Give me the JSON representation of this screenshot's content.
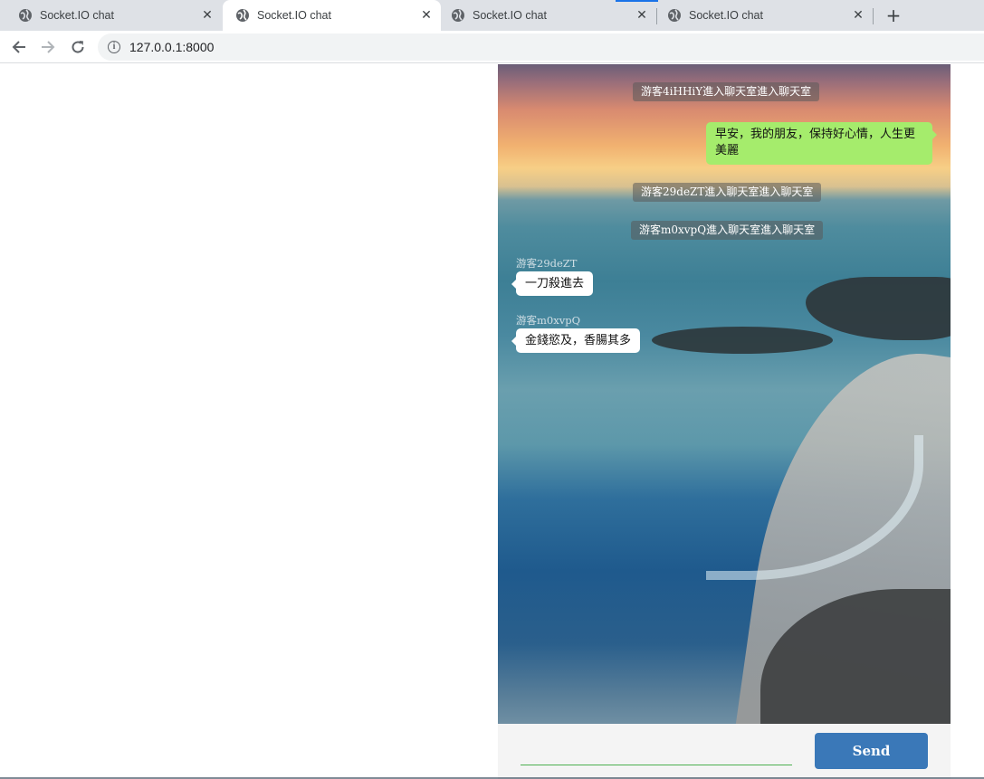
{
  "browser": {
    "tabs": [
      {
        "title": "Socket.IO chat",
        "active": false
      },
      {
        "title": "Socket.IO chat",
        "active": true
      },
      {
        "title": "Socket.IO chat",
        "active": false
      },
      {
        "title": "Socket.IO chat",
        "active": false
      }
    ],
    "new_tab_icon": "plus-icon",
    "url": "127.0.0.1:8000"
  },
  "chat": {
    "system_messages": [
      "游客4iHHiY進入聊天室進入聊天室",
      "游客29deZT進入聊天室進入聊天室",
      "游客m0xvpQ進入聊天室進入聊天室"
    ],
    "own_message": "早安，我的朋友，保持好心情，人生更美麗",
    "messages": [
      {
        "user": "游客29deZT",
        "text": "一刀殺進去"
      },
      {
        "user": "游客m0xvpQ",
        "text": "金錢慾及，香腸其多"
      }
    ],
    "input_value": "",
    "send_label": "Send"
  },
  "colors": {
    "own_bubble": "#a5ec6c",
    "send_button": "#3a78b8",
    "input_underline": "#4caf50"
  }
}
